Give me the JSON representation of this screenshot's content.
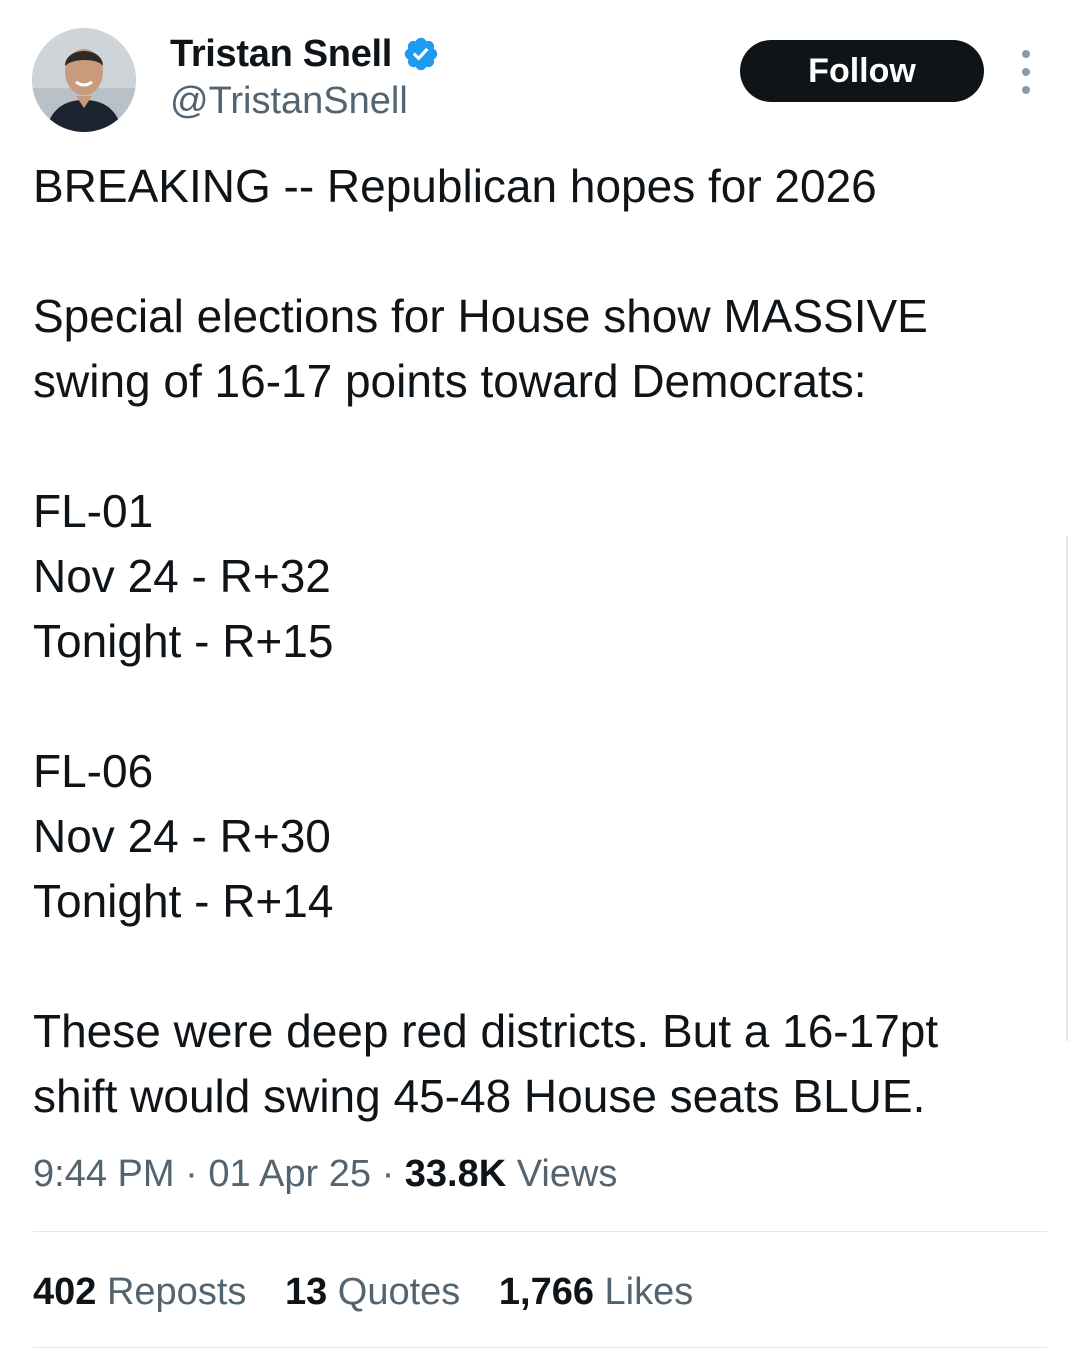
{
  "author": {
    "display_name": "Tristan Snell",
    "handle": "@TristanSnell",
    "verified": true,
    "avatar_icon": "avatar-photo"
  },
  "header": {
    "follow_label": "Follow",
    "more_icon": "more-vertical-icon"
  },
  "tweet": {
    "paragraphs": [
      [
        "BREAKING -- Republican hopes for 2026"
      ],
      [
        "Special elections for House show MASSIVE",
        "swing of 16-17 points toward Democrats:"
      ],
      [
        "FL-01",
        "Nov 24 - R+32",
        "Tonight - R+15"
      ],
      [
        "FL-06",
        "Nov 24 - R+30",
        "Tonight - R+14"
      ],
      [
        "These were deep red districts. But a 16-17pt",
        "shift would swing 45-48 House seats BLUE."
      ]
    ]
  },
  "meta": {
    "time": "9:44 PM",
    "separator": "·",
    "date": "01 Apr 25",
    "views_count": "33.8K",
    "views_label": "Views"
  },
  "stats": {
    "reposts_count": "402",
    "reposts_label": "Reposts",
    "quotes_count": "13",
    "quotes_label": "Quotes",
    "likes_count": "1,766",
    "likes_label": "Likes"
  },
  "colors": {
    "text_primary": "#0f1419",
    "text_secondary": "#536471",
    "verified_blue": "#1d9bf0",
    "follow_bg": "#0f1419",
    "divider": "#e6e9ec"
  }
}
